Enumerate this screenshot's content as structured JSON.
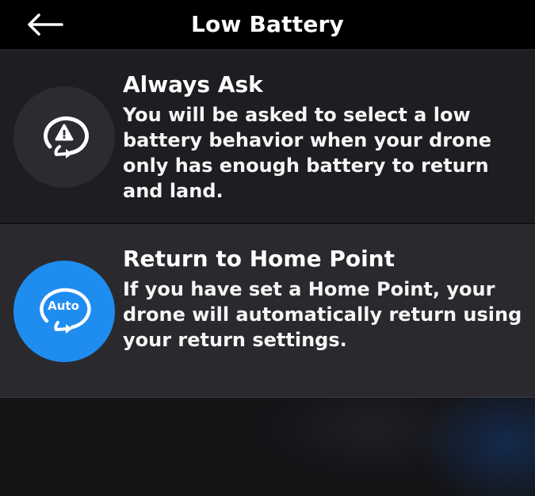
{
  "header": {
    "title": "Low Battery",
    "back_icon": "arrow-left-icon"
  },
  "options": [
    {
      "title": "Always Ask",
      "description": "You will be asked to select a low battery behavior when your drone only has enough battery to return and land.",
      "icon": "warning-return-icon",
      "selected": false
    },
    {
      "title": "Return to Home Point",
      "description": "If you have set a Home Point, your drone will automatically return using your return settings.",
      "icon": "auto-return-icon",
      "icon_label": "Auto",
      "selected": true
    }
  ],
  "colors": {
    "header_bg": "#000000",
    "accent": "#1f8cf0",
    "selected_row_bg": "#2a2a2e",
    "row_bg": "#1e1e22"
  }
}
